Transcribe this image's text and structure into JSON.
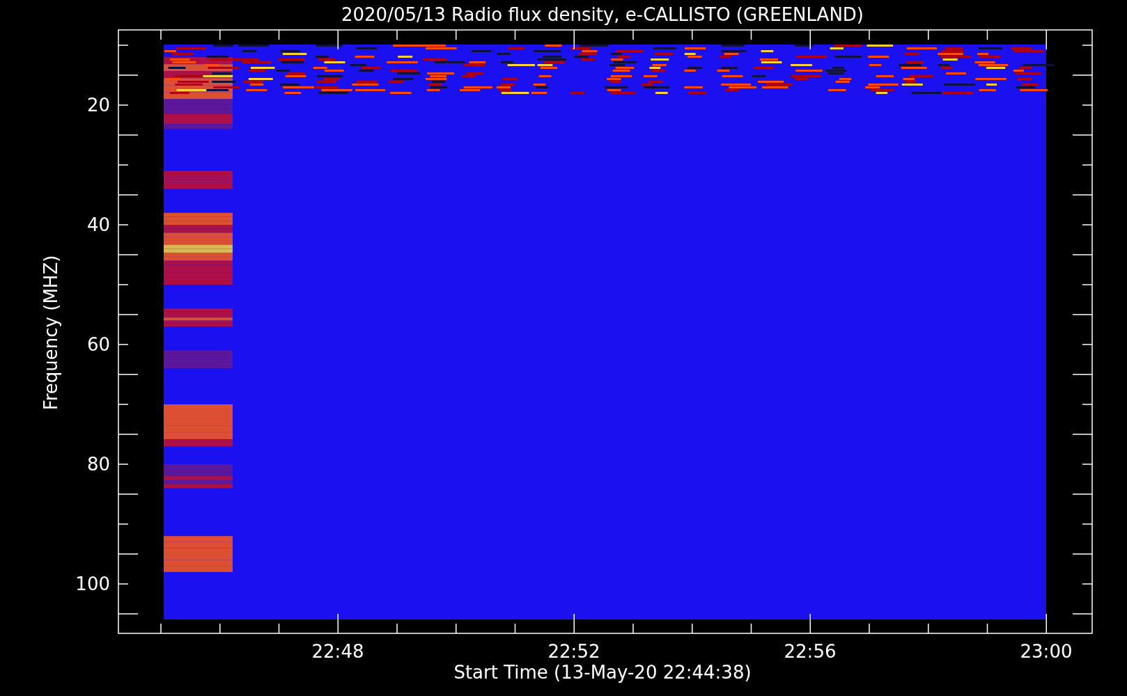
{
  "title": "2020/05/13  Radio flux density, e-CALLISTO (GREENLAND)",
  "y_axis": {
    "label": "Frequency (MHZ)",
    "ticks": [
      "20",
      "40",
      "60",
      "80",
      "100"
    ]
  },
  "x_axis": {
    "label": "Start Time (13-May-20 22:44:38)",
    "ticks": [
      "22:48",
      "22:52",
      "22:56",
      "23:00"
    ]
  }
}
